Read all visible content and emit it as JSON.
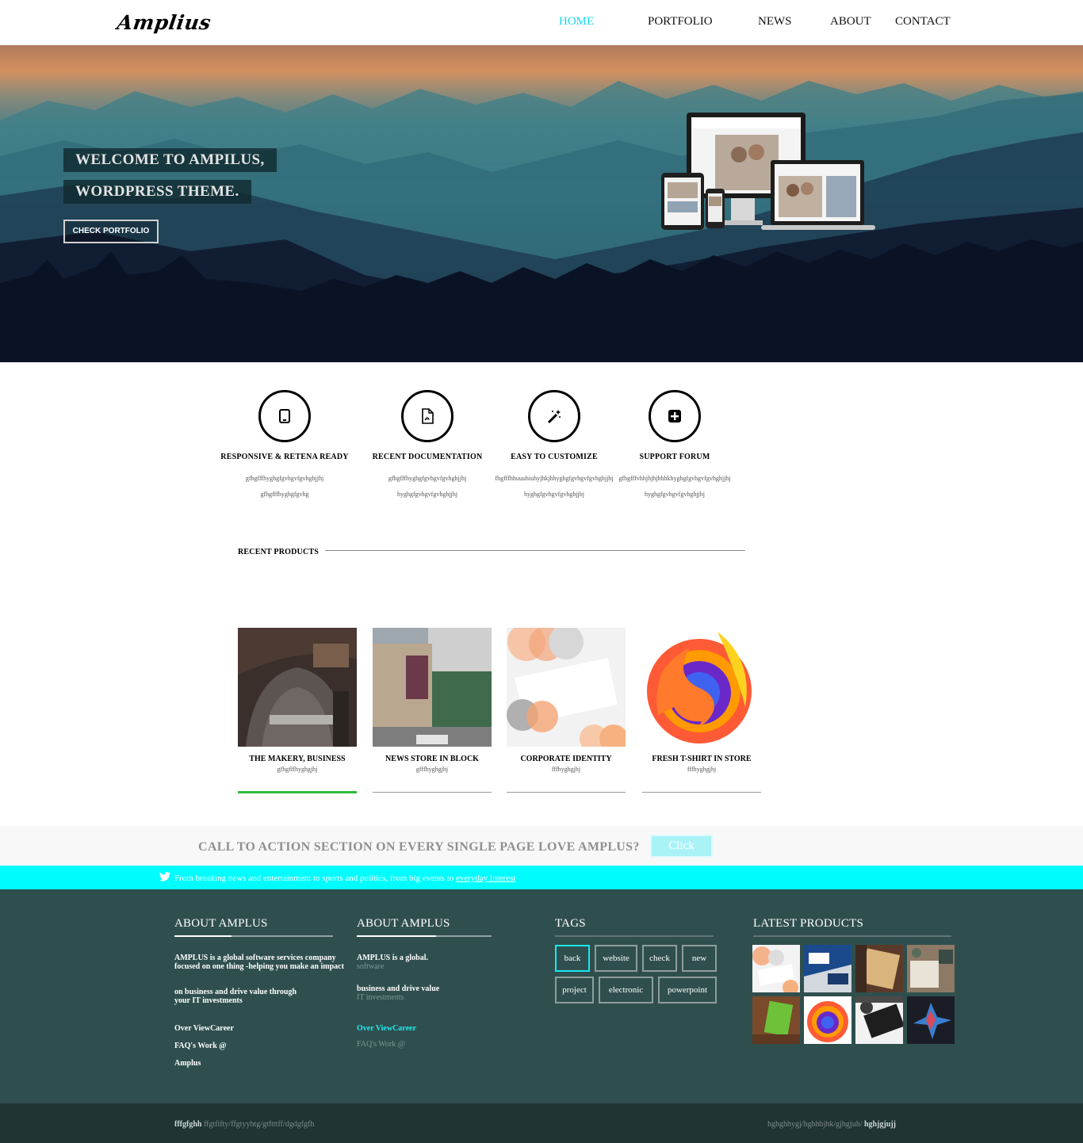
{
  "brand": {
    "logo": "Amplius"
  },
  "nav": {
    "home": "HOME",
    "portfolio": "PORTFOLIO",
    "news": "NEWS",
    "about": "ABOUT",
    "contact": "CONTACT",
    "active_color": "#18d7e8"
  },
  "hero": {
    "line1": "WELCOME TO AMPILUS,",
    "line2": "WORDPRESS THEME.",
    "button": "CHECK PORTFOLIO"
  },
  "features": [
    {
      "icon": "tablet-icon",
      "title": "RESPONSIVE & RETENA READY",
      "desc1": "gfhgfffhyghgfgvhgvfgvhghjjhj",
      "desc2": "gfhgfffhyghgfgvhg"
    },
    {
      "icon": "pdf-file-icon",
      "title": "RECENT DOCUMENTATION",
      "desc1": "gfhgfffhyghgfgvhgvfgvhghjjhj",
      "desc2": "hyghgfgvhgvfgvhghjjhj"
    },
    {
      "icon": "magic-wand-icon",
      "title": "EASY TO CUSTOMIZE",
      "desc1": "fhgfffhhuuuhiuhyjhkjhhyghgfgvhgvfgvhghjjhj",
      "desc2": "hyghgfgvhgvfgvhghjjhj"
    },
    {
      "icon": "plus-square-icon",
      "title": "SUPPORT FORUM",
      "desc1": "gfhgfffvhhjhjhjhhhkhyghgfgvhgvfgvhghjjhj",
      "desc2": "hyghgfgvhgvfgvhghjjhj"
    }
  ],
  "recent_products": {
    "title": "RECENT PRODUCTS",
    "items": [
      {
        "name": "THE MAKERY, BUSINESS",
        "desc": "gfhgfffhyghgjhj"
      },
      {
        "name": "NEWS STORE IN BLOCK",
        "desc": "gfffhyghgjhj"
      },
      {
        "name": "CORPORATE IDENTITY",
        "desc": "fffhyghgjhj"
      },
      {
        "name": "FRESH T-SHIRT IN STORE",
        "desc": "fffhyghgjhj"
      }
    ]
  },
  "cta": {
    "text": "CALL TO ACTION SECTION ON EVERY SINGLE PAGE LOVE AMPLUS?",
    "button": "Click"
  },
  "twitter": {
    "text": "From breaking news and entertainment to sports and politics, from big events to",
    "link": "everyday interest"
  },
  "footer": {
    "col1": {
      "title": "ABOUT AMPLUS",
      "para1_l1": "AMPLUS is a global software services company",
      "para1_l2": "focused on one thing -helping you make an impact",
      "para2_l1": "on business and drive value through",
      "para2_l2": "your IT investments",
      "link1": "Over ViewCareer",
      "link2": "FAQ's Work @",
      "link3": "Amplus"
    },
    "col2": {
      "title": "ABOUT AMPLUS",
      "p1": "AMPLUS is a global.",
      "p1_sub": "software",
      "p2": "business and drive value",
      "p2_sub": "IT investments",
      "link1": "Over ViewCareer",
      "link2": "FAQ's Work @"
    },
    "tags": {
      "title": "TAGS",
      "items": [
        "back",
        "website",
        "check",
        "new",
        "project",
        "electronic",
        "powerpoint"
      ]
    },
    "latest": {
      "title": "LATEST PRODUCTS"
    }
  },
  "bottom": {
    "left_bold": "fffgfghh",
    "left_rest": " ffgtfifty/ffgtyyhtg/gtftttff/dgdgfgfh",
    "right_rest": "hghghhygj/hgbhbjhk/gjhgjuh/ ",
    "right_bold": "hghjgjujj"
  }
}
